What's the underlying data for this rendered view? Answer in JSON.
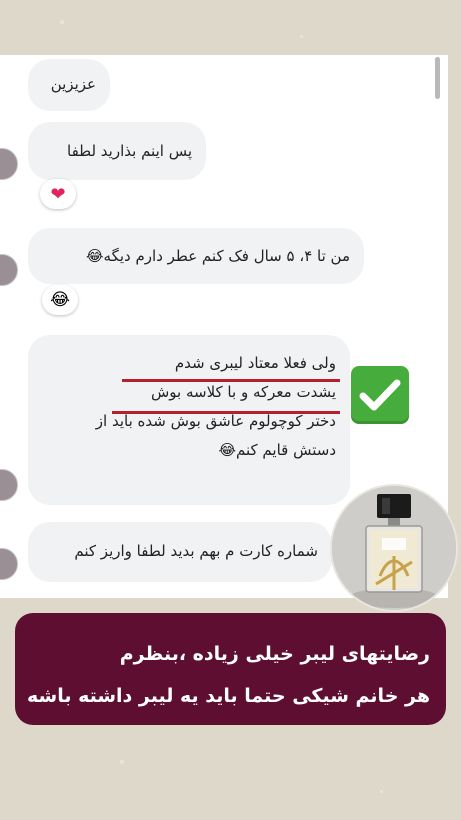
{
  "messages": [
    {
      "id": "m1",
      "text": "عزیزین"
    },
    {
      "id": "m2",
      "text": "پس اینم بذارید لطفا",
      "reaction": "❤"
    },
    {
      "id": "m3",
      "text": "من تا ۴، ۵ سال فک کنم عطر دارم دیگه😂",
      "reaction": "😂"
    },
    {
      "id": "m4",
      "lines": [
        "ولی فعلا معتاد لیبری شدم",
        "یشدت معرکه و با کلاسه بوش",
        "دختر کوچولوم عاشق بوش شده باید از",
        "دستش قایم کنم😂"
      ]
    },
    {
      "id": "m5",
      "text": "شماره کارت م بهم بدید لطفا واریز کنم"
    }
  ],
  "banner": {
    "line1": "رضایتهای لیبر خیلی زیاده ،بنظرم",
    "line2": "هر خانم شیکی حتما باید یه لیبر داشته باشه"
  },
  "colors": {
    "banner_bg": "#5e0f31",
    "underline": "#b51f2e",
    "check_bg": "#46ad3c",
    "bubble_bg": "#f1f2f4"
  },
  "icons": {
    "reaction_heart": "heart-icon",
    "reaction_laugh": "laugh-icon",
    "check": "check-mark-icon",
    "product": "perfume-bottle-icon"
  }
}
